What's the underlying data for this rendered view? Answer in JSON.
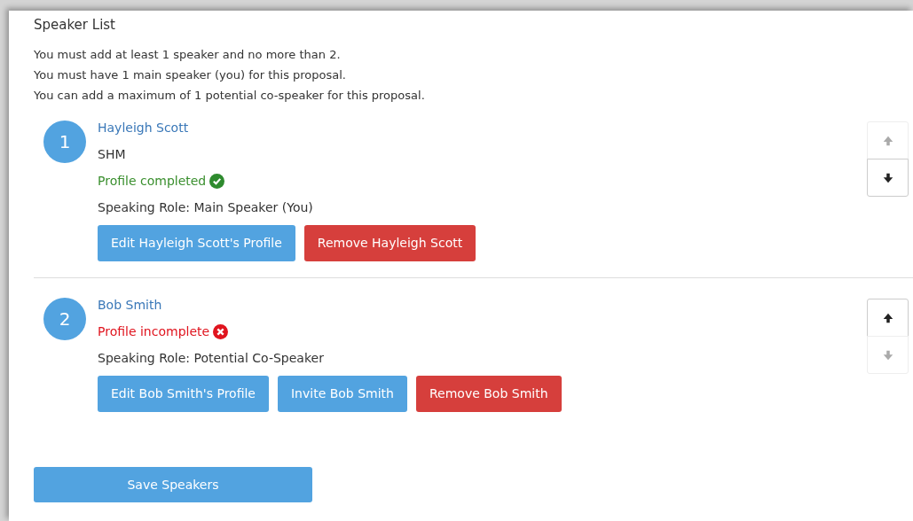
{
  "heading": "Speaker List",
  "rules": [
    "You must add at least 1 speaker and no more than 2.",
    "You must have 1 main speaker (you) for this proposal.",
    "You can add a maximum of 1 potential co-speaker for this proposal."
  ],
  "speakers": [
    {
      "number": "1",
      "name": "Hayleigh Scott",
      "organization": "SHM",
      "profile_status": "Profile completed",
      "profile_complete": true,
      "role": "Speaking Role: Main Speaker (You)",
      "buttons": [
        {
          "label": "Edit Hayleigh Scott's Profile",
          "kind": "primary"
        },
        {
          "label": "Remove Hayleigh Scott",
          "kind": "danger"
        }
      ],
      "move_up_disabled": true,
      "move_down_disabled": false
    },
    {
      "number": "2",
      "name": "Bob Smith",
      "profile_status": "Profile incomplete",
      "profile_complete": false,
      "role": "Speaking Role: Potential Co-Speaker",
      "buttons": [
        {
          "label": "Edit Bob Smith's Profile",
          "kind": "primary"
        },
        {
          "label": "Invite Bob Smith",
          "kind": "primary"
        },
        {
          "label": "Remove Bob Smith",
          "kind": "danger"
        }
      ],
      "move_up_disabled": false,
      "move_down_disabled": true
    }
  ],
  "save_button": "Save Speakers"
}
